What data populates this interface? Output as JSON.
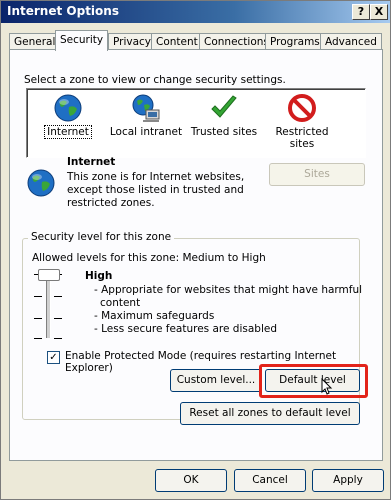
{
  "window": {
    "title": "Internet Options",
    "help_button": "?",
    "close_button": "X"
  },
  "tabs": [
    {
      "label": "General",
      "active": false
    },
    {
      "label": "Security",
      "active": true
    },
    {
      "label": "Privacy",
      "active": false
    },
    {
      "label": "Content",
      "active": false
    },
    {
      "label": "Connections",
      "active": false
    },
    {
      "label": "Programs",
      "active": false
    },
    {
      "label": "Advanced",
      "active": false
    }
  ],
  "security": {
    "instruction": "Select a zone to view or change security settings.",
    "zones": [
      {
        "label": "Internet",
        "icon": "globe-icon",
        "selected": true
      },
      {
        "label": "Local intranet",
        "icon": "intranet-icon",
        "selected": false
      },
      {
        "label": "Trusted sites",
        "icon": "checkmark-icon",
        "selected": false
      },
      {
        "label": "Restricted sites",
        "icon": "restricted-icon",
        "selected": false
      }
    ],
    "zone_info": {
      "title": "Internet",
      "description": "This zone is for Internet websites, except those listed in trusted and restricted zones.",
      "icon": "globe-icon"
    },
    "sites_button": "Sites",
    "level_group": {
      "title": "Security level for this zone",
      "allowed": "Allowed levels for this zone: Medium to High",
      "level_name": "High",
      "slider_level": "High",
      "bullets": [
        "- Appropriate for websites that might have harmful",
        "  content",
        "- Maximum safeguards",
        "- Less secure features are disabled"
      ],
      "protected_mode_label": "Enable Protected Mode (requires restarting Internet Explorer)",
      "protected_mode_checked": true,
      "custom_level_button": "Custom level...",
      "default_level_button": "Default level"
    },
    "reset_button": "Reset all zones to default level"
  },
  "footer": {
    "ok": "OK",
    "cancel": "Cancel",
    "apply": "Apply"
  },
  "colors": {
    "highlight": "#e2231a",
    "titlebar": "#0a246a"
  }
}
